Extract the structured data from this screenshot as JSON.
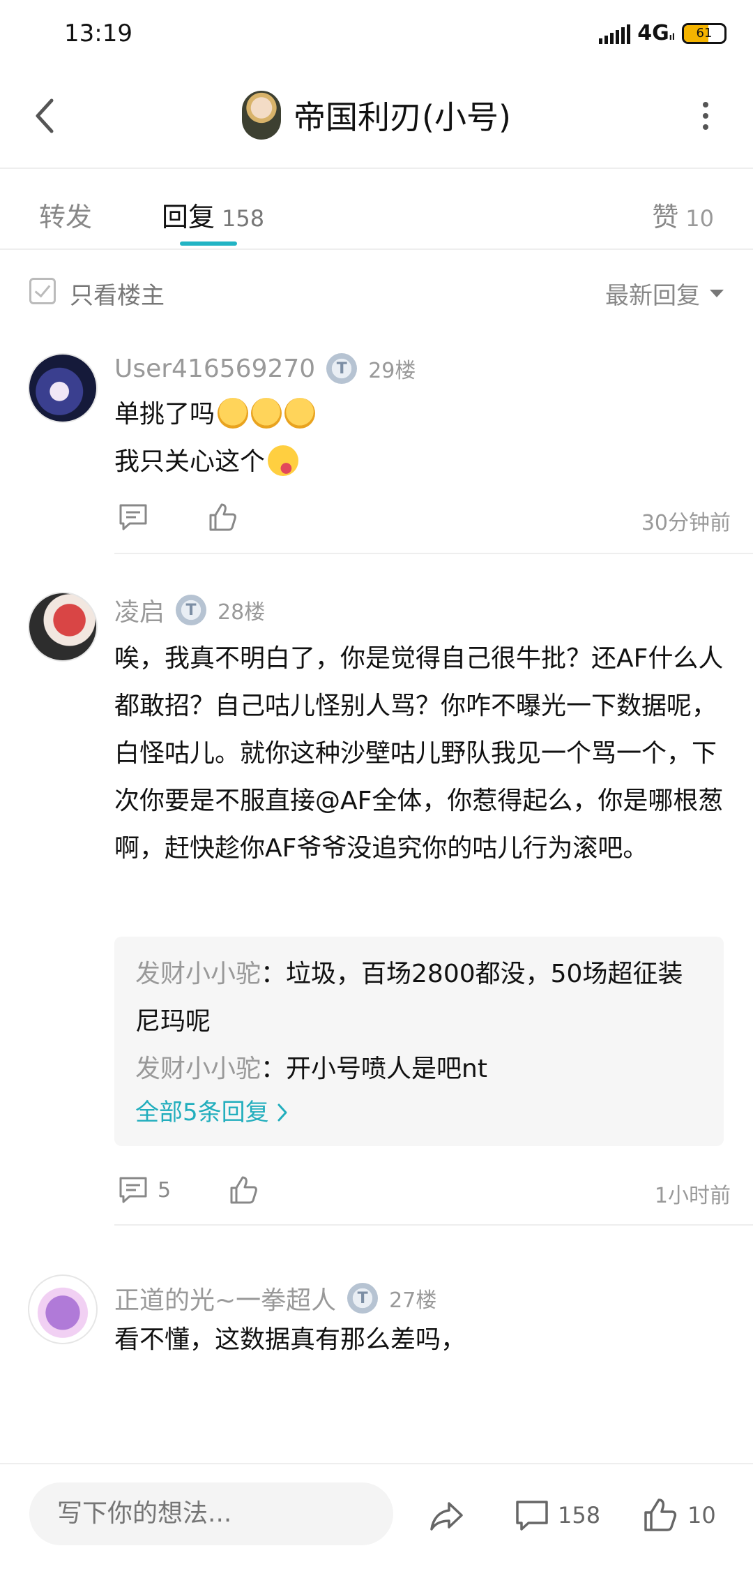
{
  "status_bar": {
    "time": "13:19",
    "network": "4G",
    "battery_level": "61"
  },
  "header": {
    "title": "帝国利刃(小号)"
  },
  "tabs": {
    "forward": {
      "label": "转发"
    },
    "reply": {
      "label": "回复",
      "count": "158"
    },
    "like": {
      "label": "赞",
      "count": "10"
    }
  },
  "filter": {
    "only_op_label": "只看楼主",
    "sort_label": "最新回复"
  },
  "comments": [
    {
      "user": "User416569270",
      "floor": "29楼",
      "line1": "单挑了吗",
      "line2": "我只关心这个",
      "time": "30分钟前"
    },
    {
      "user": "凌启",
      "floor": "28楼",
      "text": "唉，我真不明白了，你是觉得自己很牛批？还AF什么人都敢招？自己咕儿怪别人骂？你咋不曝光一下数据呢，白怪咕儿。就你这种沙壁咕儿野队我见一个骂一个，下次你要是不服直接@AF全体，你惹得起么，你是哪根葱啊，赶快趁你AF爷爷没追究你的咕儿行为滚吧。",
      "replies": [
        {
          "user": "发财小小驼",
          "text": "垃圾，百场2800都没，50场超征装尼玛呢"
        },
        {
          "user": "发财小小驼",
          "text": "开小号喷人是吧nt"
        }
      ],
      "more_replies": "全部5条回复",
      "comment_count": "5",
      "time": "1小时前"
    },
    {
      "user": "正道的光~一拳超人",
      "floor": "27楼",
      "text": "看不懂，这数据真有那么差吗，"
    }
  ],
  "bottom_bar": {
    "input_placeholder": "写下你的想法...",
    "comment_count": "158",
    "like_count": "10"
  }
}
